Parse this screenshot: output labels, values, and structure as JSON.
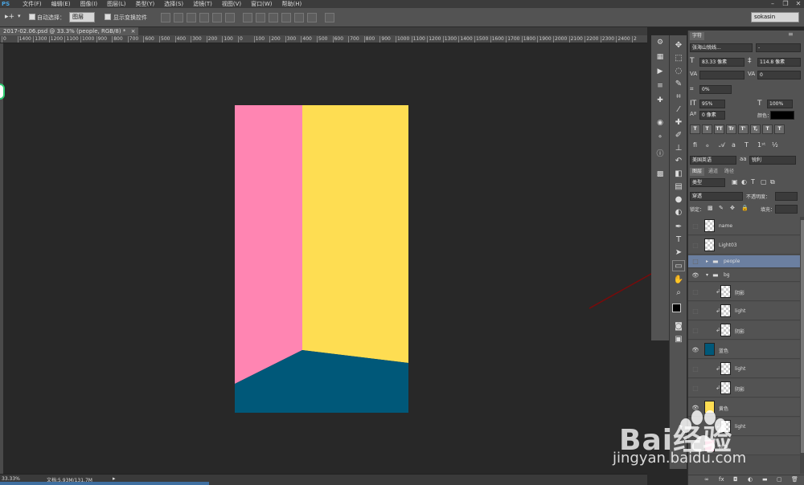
{
  "menu": {
    "app_abbr": "PS",
    "items": [
      "文件(F)",
      "编辑(E)",
      "图像(I)",
      "图层(L)",
      "类型(Y)",
      "选择(S)",
      "滤镜(T)",
      "视图(V)",
      "窗口(W)",
      "帮助(H)"
    ]
  },
  "options_bar": {
    "auto_select_label": "自动选择：",
    "auto_select_value": "图层",
    "show_transform_label": "显示变换控件",
    "workspace": "sokasin"
  },
  "document": {
    "tab_title": "2017-02.06.psd @ 33.3% (people, RGB/8) *",
    "close": "×",
    "ruler_ticks": [
      "0",
      "1400",
      "1300",
      "1200",
      "1100",
      "1000",
      "900",
      "800",
      "700",
      "600",
      "500",
      "400",
      "300",
      "200",
      "100",
      "0",
      "100",
      "200",
      "300",
      "400",
      "500",
      "600",
      "700",
      "800",
      "900",
      "1000",
      "1100",
      "1200",
      "1300",
      "1400",
      "1500",
      "1600",
      "1700",
      "1800",
      "1900",
      "2000",
      "2100",
      "2200",
      "2300",
      "2400",
      "2"
    ]
  },
  "artwork": {
    "left_wall": "#ff85b2",
    "right_wall": "#fedd52",
    "floor": "#005879"
  },
  "status": {
    "zoom": "33.33%",
    "doc_info": "文档:5.93M/131.7M"
  },
  "char_panel": {
    "tab": "字符",
    "font_family": "张海山锐线...",
    "font_style": "-",
    "font_size": "83.33 像素",
    "leading": "114.8 像素",
    "kerning": "",
    "tracking": "0",
    "scale_pct": "0%",
    "vscale": "95%",
    "hscale": "100%",
    "baseline": "0 像素",
    "color_label": "颜色：",
    "type_buttons": [
      "T",
      "T",
      "TT",
      "Tr",
      "T'",
      "T,",
      "T",
      "T"
    ],
    "language": "美国英语",
    "antialias": "锐利"
  },
  "layers_panel": {
    "tabs": [
      "图层",
      "通道",
      "路径"
    ],
    "filter": "类型",
    "blend_mode": "穿透",
    "opacity_label": "不透明度：",
    "lock_label": "锁定：",
    "fill_label": "填充：",
    "layers": [
      {
        "name": "name",
        "visible": false,
        "type": "layer"
      },
      {
        "name": "Light03",
        "visible": false,
        "type": "layer"
      },
      {
        "name": "people",
        "visible": false,
        "type": "group",
        "selected": true
      },
      {
        "name": "bg",
        "visible": true,
        "type": "group"
      },
      {
        "name": "阴影",
        "visible": false,
        "type": "clip"
      },
      {
        "name": "light",
        "visible": false,
        "type": "clip"
      },
      {
        "name": "阴影",
        "visible": false,
        "type": "clip"
      },
      {
        "name": "蓝色",
        "visible": true,
        "type": "layer",
        "color": "#005879"
      },
      {
        "name": "light",
        "visible": false,
        "type": "clip"
      },
      {
        "name": "阴影",
        "visible": false,
        "type": "clip"
      },
      {
        "name": "黄色",
        "visible": true,
        "type": "layer",
        "color": "#fedd52"
      },
      {
        "name": "light",
        "visible": false,
        "type": "clip"
      },
      {
        "name": "粉色",
        "visible": false,
        "type": "layer",
        "color": "#ff85b2"
      }
    ],
    "bottom_icons": [
      "link-icon",
      "fx-icon",
      "mask-icon",
      "adjustment-icon",
      "folder-icon",
      "new-layer-icon",
      "trash-icon"
    ]
  },
  "watermark": {
    "brand": "Bai经验",
    "url": "jingyan.baidu.com"
  },
  "colors": {
    "ui_dark": "#282828",
    "ui_panel": "#535353",
    "selected_row": "#6b7fa0",
    "arrow": "#7a0a0a"
  }
}
